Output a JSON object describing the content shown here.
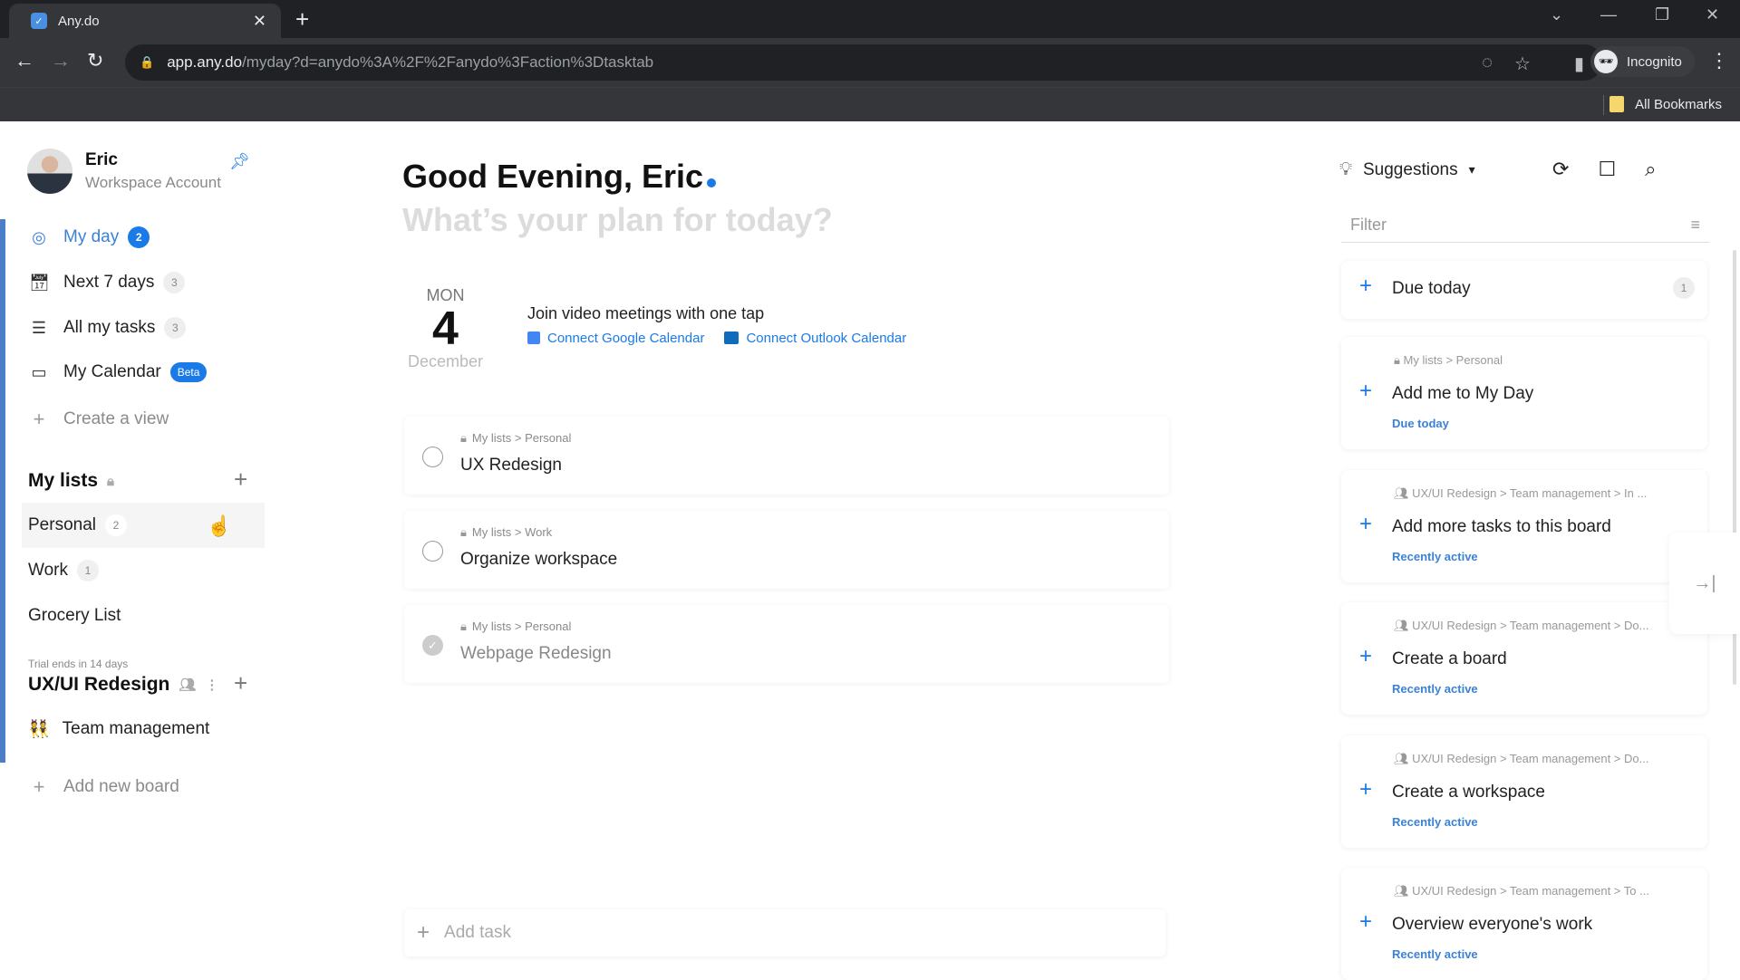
{
  "browser": {
    "tab_title": "Any.do",
    "url_host": "app.any.do",
    "url_path": "/myday?d=anydo%3A%2F%2Fanydo%3Faction%3Dtasktab",
    "profile_label": "Incognito",
    "bookmarks_label": "All Bookmarks"
  },
  "sidebar": {
    "user_name": "Eric",
    "account_type": "Workspace Account",
    "nav": [
      {
        "label": "My day",
        "count": "2"
      },
      {
        "label": "Next 7 days",
        "count": "3"
      },
      {
        "label": "All my tasks",
        "count": "3"
      },
      {
        "label": "My Calendar",
        "badge": "Beta"
      },
      {
        "label": "Create a view"
      }
    ],
    "my_lists_title": "My lists",
    "lists": [
      {
        "label": "Personal",
        "count": "2"
      },
      {
        "label": "Work",
        "count": "1"
      },
      {
        "label": "Grocery List"
      }
    ],
    "trial_text": "Trial ends in 14 days",
    "workspace_title": "UX/UI Redesign",
    "boards": [
      {
        "label": "Team management"
      }
    ],
    "add_board_label": "Add new board"
  },
  "main": {
    "greeting": "Good Evening, Eric",
    "subtitle": "What’s your plan for today?",
    "date": {
      "dow": "MON",
      "day": "4",
      "month": "December"
    },
    "meetings_label": "Join video meetings with one tap",
    "connect_google": "Connect Google Calendar",
    "connect_outlook": "Connect Outlook Calendar",
    "tasks": [
      {
        "crumb": "My lists > Personal",
        "name": "UX Redesign",
        "done": false
      },
      {
        "crumb": "My lists > Work",
        "name": "Organize workspace",
        "done": false
      },
      {
        "crumb": "My lists > Personal",
        "name": "Webpage Redesign",
        "done": true
      }
    ],
    "add_task_placeholder": "Add task"
  },
  "suggestions": {
    "title": "Suggestions",
    "filter_placeholder": "Filter",
    "due_today": {
      "label": "Due today",
      "count": "1"
    },
    "items": [
      {
        "crumb": "My lists > Personal",
        "name": "Add me to My Day",
        "meta": "Due today",
        "icon": "lock-icon"
      },
      {
        "crumb": "UX/UI Redesign > Team management > In ...",
        "name": "Add more tasks to this board",
        "meta": "Recently active",
        "icon": "people-icon"
      },
      {
        "crumb": "UX/UI Redesign > Team management > Do...",
        "name": "Create a board",
        "meta": "Recently active",
        "icon": "people-icon"
      },
      {
        "crumb": "UX/UI Redesign > Team management > Do...",
        "name": "Create a workspace",
        "meta": "Recently active",
        "icon": "people-icon"
      },
      {
        "crumb": "UX/UI Redesign > Team management > To ...",
        "name": "Overview everyone's work",
        "meta": "Recently active",
        "icon": "people-icon"
      }
    ]
  },
  "colors": {
    "accent": "#1a7be8",
    "link": "#3b82d6",
    "sidebar_bar": "#4a7fc8"
  }
}
